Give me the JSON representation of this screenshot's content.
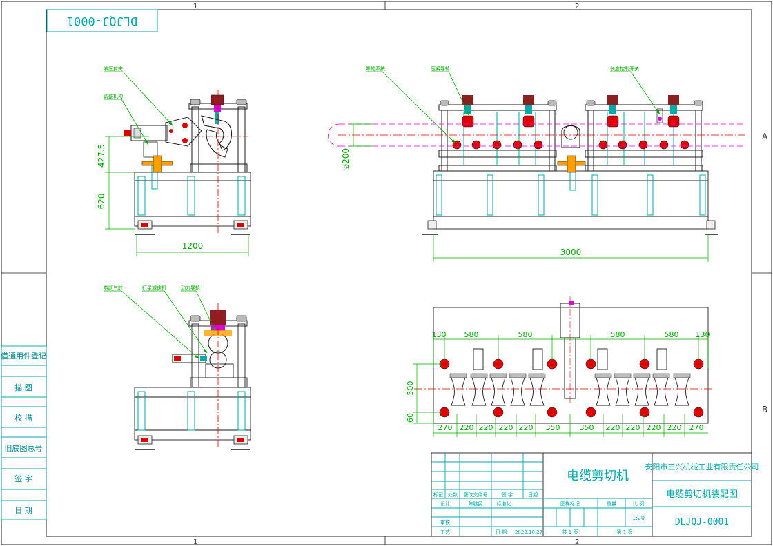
{
  "colors": {
    "outline": "#1b1b1b",
    "cyan": "#00aaaa",
    "green": "#00aa00",
    "red": "#e00000",
    "magenta": "#e000e0",
    "orange": "#ffa000",
    "tan": "#c8c800",
    "brown": "#8b2020"
  },
  "zones": {
    "top": [
      "1",
      "2"
    ],
    "bottom": [
      "1",
      "2"
    ],
    "right": [
      "A",
      "B"
    ]
  },
  "drawing_number_stamp": "DLJQJ-0001",
  "side_panel": [
    "借通用件登记",
    "描 图",
    "校 描",
    "旧底图总号",
    "签 字",
    "日 期"
  ],
  "views": {
    "front": {
      "callouts": [
        "液压剪夹",
        "调整机构"
      ],
      "dims": {
        "height_upper": "427.5",
        "height_lower": "620",
        "width": "1200"
      }
    },
    "side": {
      "callouts": [
        "导轮系统",
        "压紧导轮",
        "长度控制开关"
      ],
      "dims": {
        "diameter": "ø200",
        "length": "3000"
      }
    },
    "section": {
      "callouts": [
        "剪断气缸",
        "行星减速机",
        "动力导轮"
      ]
    },
    "plan": {
      "top_dims": [
        "130",
        "580",
        "580",
        "580",
        "580",
        "130"
      ],
      "left_dims": [
        "500",
        "60"
      ],
      "bottom_dims": [
        "270",
        "220",
        "220",
        "220",
        "220",
        "350",
        "350",
        "220",
        "220",
        "220",
        "220",
        "270"
      ]
    }
  },
  "title_block": {
    "product_name": "电缆剪切机",
    "company": "安阳市三兴机械工业有限责任公司",
    "drawing_title": "电缆剪切机装配图",
    "drawing_number": "DLJQJ-0001",
    "revision_headers": [
      "标记",
      "处数",
      "更改文件号",
      "签 字",
      "日期"
    ],
    "design": {
      "label": "设计",
      "name": "陈胜民",
      "std_label": "标准化"
    },
    "review_label": "审核",
    "process_label": "工艺",
    "date_label": "日 期",
    "date_value": "2023.10.27",
    "stage_label": "图样标记",
    "weight_label": "重量",
    "scale_label": "比 例",
    "scale_value": "1:20",
    "sheets_total": "共 1 页",
    "sheet_current": "第 1 页"
  }
}
